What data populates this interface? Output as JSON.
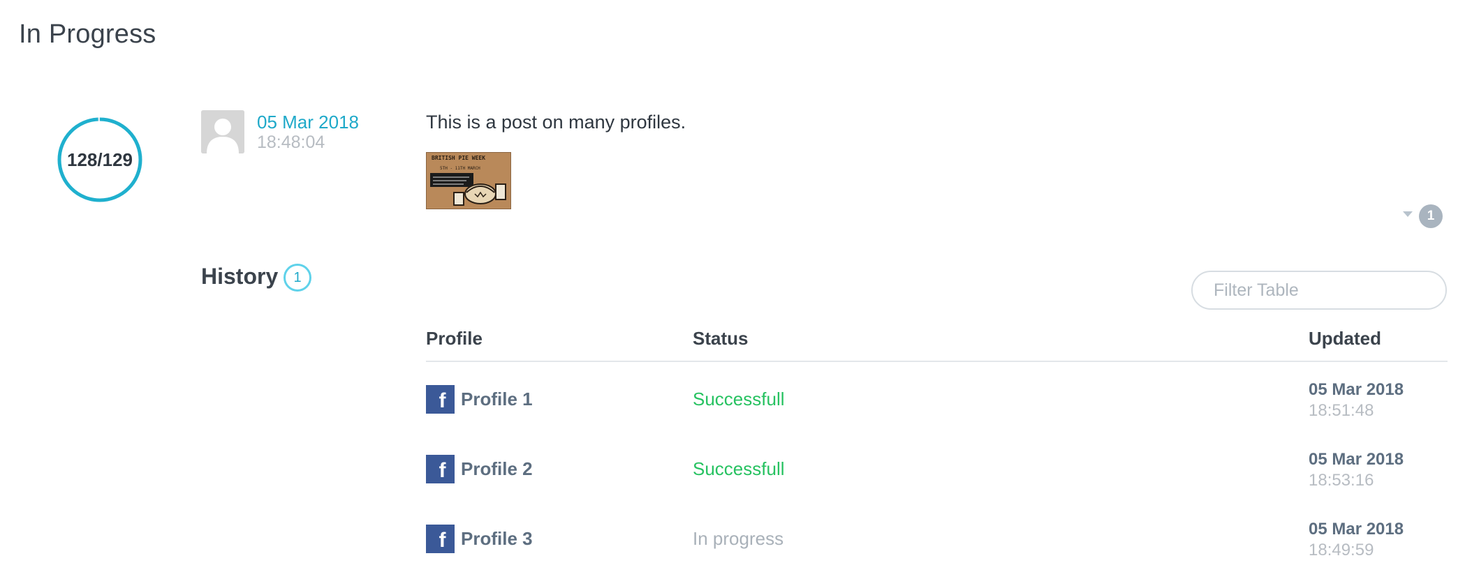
{
  "page": {
    "title": "In Progress"
  },
  "progress": {
    "label": "128/129",
    "completed": 128,
    "total": 129,
    "color": "#1fb0ce"
  },
  "post": {
    "date": "05 Mar 2018",
    "time": "18:48:04",
    "text": "This is a post on many profiles.",
    "image_caption": "BRITISH PIE WEEK",
    "image_subcaption": "5TH - 11TH MARCH",
    "comment_count": "1"
  },
  "history": {
    "title": "History",
    "count": "1",
    "filter_placeholder": "Filter Table",
    "columns": {
      "profile": "Profile",
      "status": "Status",
      "updated": "Updated"
    },
    "rows": [
      {
        "network": "f",
        "profile": "Profile 1",
        "status": "Successfull",
        "status_type": "success",
        "date": "05 Mar 2018",
        "time": "18:51:48"
      },
      {
        "network": "f",
        "profile": "Profile 2",
        "status": "Successfull",
        "status_type": "success",
        "date": "05 Mar 2018",
        "time": "18:53:16"
      },
      {
        "network": "f",
        "profile": "Profile 3",
        "status": "In progress",
        "status_type": "progress",
        "date": "05 Mar 2018",
        "time": "18:49:59"
      }
    ]
  },
  "colors": {
    "accent": "#1fa9c9",
    "success": "#27c261",
    "facebook": "#3b5998",
    "muted": "#b7bcc2"
  }
}
